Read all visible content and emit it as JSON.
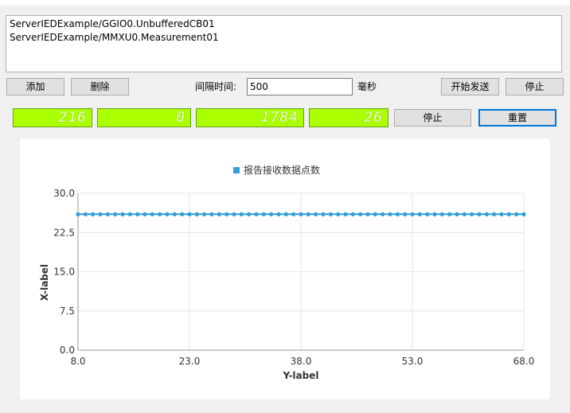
{
  "list": {
    "items": [
      "ServerIEDExample/GGIO0.UnbufferedCB01",
      "ServerIEDExample/MMXU0.Measurement01"
    ]
  },
  "toolbar": {
    "add_label": "添加",
    "delete_label": "删除",
    "interval_label": "间隔时间:",
    "interval_value": "500",
    "unit_label": "毫秒",
    "start_label": "开始发送",
    "stop_label": "停止"
  },
  "counters": {
    "values": [
      "216",
      "0",
      "1784",
      "26"
    ],
    "stop_label": "停止",
    "reset_label": "重置"
  },
  "colors": {
    "lcd": "#aaff00",
    "series": "#2f9fd8",
    "accent": "#0078d7"
  },
  "chart_data": {
    "type": "line",
    "legend": "报告接收数据点数",
    "legend_position": "top-center",
    "xlabel": "Y-label",
    "ylabel": "X-label",
    "xlim": [
      8.0,
      68.0
    ],
    "ylim": [
      0.0,
      30.0
    ],
    "x_ticks": [
      "8.0",
      "23.0",
      "38.0",
      "53.0",
      "68.0"
    ],
    "y_ticks": [
      "0.0",
      "7.5",
      "15.0",
      "22.5",
      "30.0"
    ],
    "grid": true,
    "series": [
      {
        "name": "报告接收数据点数",
        "x": [
          8,
          9,
          10,
          11,
          12,
          13,
          14,
          15,
          16,
          17,
          18,
          19,
          20,
          21,
          22,
          23,
          24,
          25,
          26,
          27,
          28,
          29,
          30,
          31,
          32,
          33,
          34,
          35,
          36,
          37,
          38,
          39,
          40,
          41,
          42,
          43,
          44,
          45,
          46,
          47,
          48,
          49,
          50,
          51,
          52,
          53,
          54,
          55,
          56,
          57,
          58,
          59,
          60,
          61,
          62,
          63,
          64,
          65,
          66,
          67,
          68
        ],
        "y": [
          26,
          26,
          26,
          26,
          26,
          26,
          26,
          26,
          26,
          26,
          26,
          26,
          26,
          26,
          26,
          26,
          26,
          26,
          26,
          26,
          26,
          26,
          26,
          26,
          26,
          26,
          26,
          26,
          26,
          26,
          26,
          26,
          26,
          26,
          26,
          26,
          26,
          26,
          26,
          26,
          26,
          26,
          26,
          26,
          26,
          26,
          26,
          26,
          26,
          26,
          26,
          26,
          26,
          26,
          26,
          26,
          26,
          26,
          26,
          26,
          26
        ]
      }
    ]
  }
}
